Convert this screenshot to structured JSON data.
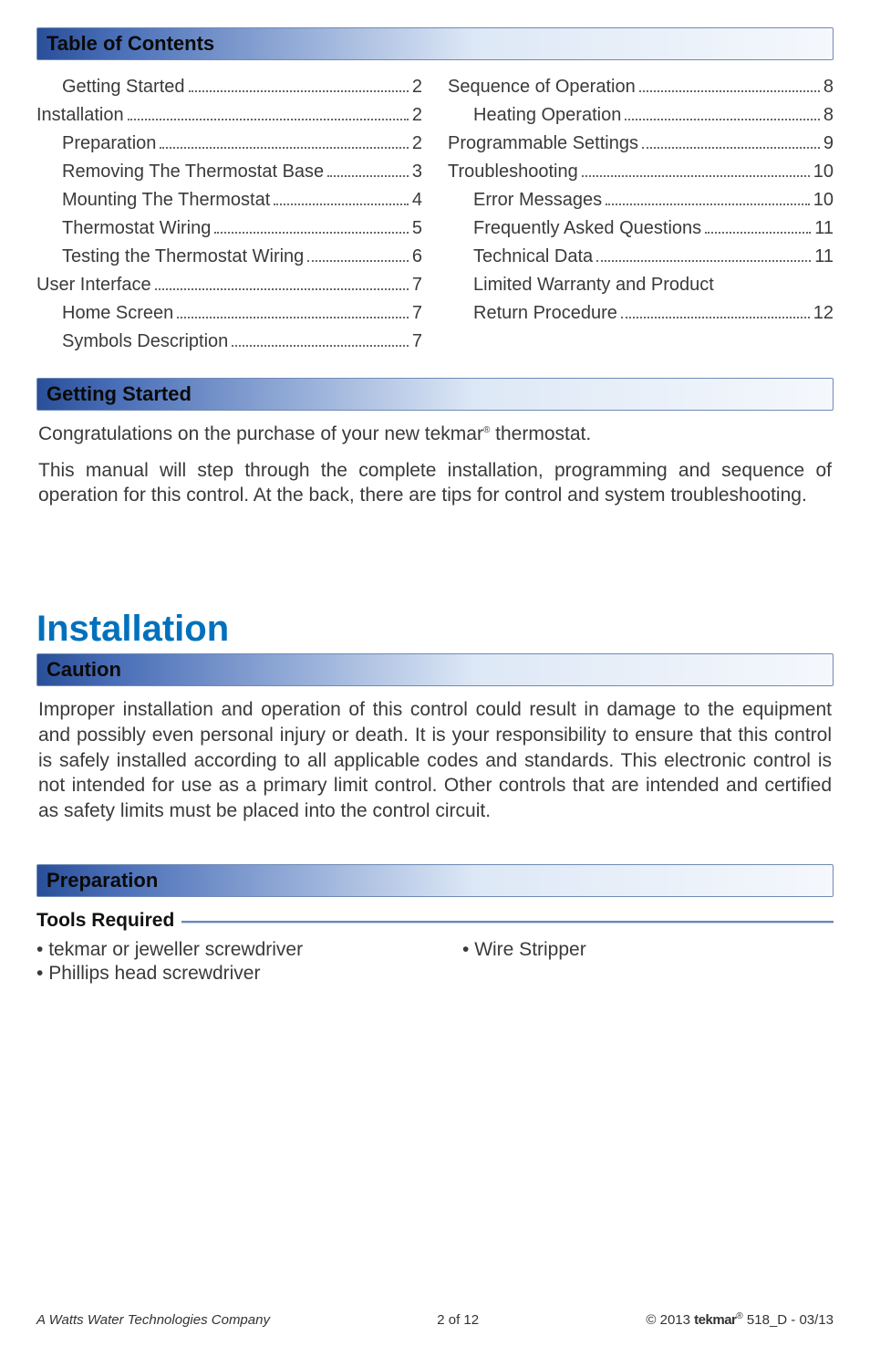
{
  "headings": {
    "toc": "Table of Contents",
    "getting_started": "Getting Started",
    "installation": "Installation",
    "caution": "Caution",
    "preparation": "Preparation",
    "tools_required": "Tools Required"
  },
  "toc": {
    "left": [
      {
        "label": "Getting Started",
        "page": "2",
        "indent": 1
      },
      {
        "label": "Installation",
        "page": "2",
        "indent": 0
      },
      {
        "label": "Preparation",
        "page": "2",
        "indent": 1
      },
      {
        "label": "Removing The Thermostat Base",
        "page": "3",
        "indent": 1
      },
      {
        "label": "Mounting The Thermostat",
        "page": "4",
        "indent": 1
      },
      {
        "label": "Thermostat Wiring",
        "page": "5",
        "indent": 1
      },
      {
        "label": "Testing the Thermostat Wiring",
        "page": "6",
        "indent": 1
      },
      {
        "label": "User Interface",
        "page": "7",
        "indent": 0
      },
      {
        "label": "Home Screen",
        "page": "7",
        "indent": 1
      },
      {
        "label": "Symbols Description",
        "page": "7",
        "indent": 1
      }
    ],
    "right": [
      {
        "label": "Sequence of Operation",
        "page": "8",
        "indent": 0
      },
      {
        "label": "Heating Operation",
        "page": "8",
        "indent": 1
      },
      {
        "label": "Programmable Settings",
        "page": "9",
        "indent": 0
      },
      {
        "label": "Troubleshooting",
        "page": "10",
        "indent": 0
      },
      {
        "label": "Error Messages",
        "page": "10",
        "indent": 1
      },
      {
        "label": "Frequently Asked Questions",
        "page": "11",
        "indent": 1
      },
      {
        "label": "Technical Data",
        "page": "11",
        "indent": 1
      },
      {
        "label": "Limited Warranty and Product Return Procedure",
        "page": "12",
        "indent": 1
      }
    ]
  },
  "getting_started": {
    "p1_a": "Congratulations on the purchase of your new tekmar",
    "p1_b": " thermostat.",
    "p2": "This manual will step through the complete installation, programming and sequence of operation for this control. At the back, there are tips for control and system troubleshooting."
  },
  "caution": {
    "p1": "Improper installation and operation of this control could result in damage to the equipment and possibly even personal injury or death. It is your responsibility to ensure that this control is safely installed according to all applicable codes and standards. This electronic control is not intended for use as a primary limit control. Other controls that are intended and certified as safety limits must be placed into the control circuit."
  },
  "tools": {
    "left": [
      "tekmar or jeweller screwdriver",
      "Phillips head screwdriver"
    ],
    "right": [
      "Wire Stripper"
    ]
  },
  "footer": {
    "left": "A Watts Water Technologies Company",
    "center": "2 of 12",
    "right_prefix": "© 2013 ",
    "right_brand": "tekmar",
    "right_suffix": " 518_D - 03/13"
  }
}
